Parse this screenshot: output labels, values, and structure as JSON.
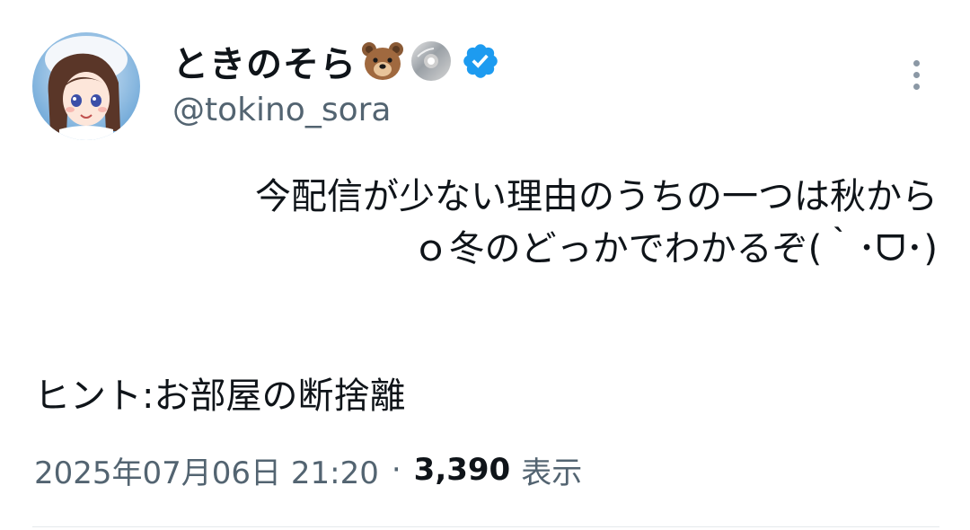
{
  "author": {
    "display_name": "ときのそら",
    "handle": "@tokino_sora",
    "emoji_icons": [
      "bear-face-icon",
      "disc-icon"
    ],
    "verified": true
  },
  "tweet": {
    "line1": "今配信が少ない理由のうちの一つは秋から",
    "line2": "ｏ冬のどっかでわかるぞ(｀･ᗜ･)",
    "hint": "ヒント:お部屋の断捨離"
  },
  "meta": {
    "timestamp": "2025年07月06日 21:20",
    "separator": "·",
    "views_count": "3,390",
    "views_label": "表示"
  },
  "colors": {
    "text": "#0f1419",
    "secondary": "#536471",
    "verified_blue": "#1d9bf0"
  }
}
